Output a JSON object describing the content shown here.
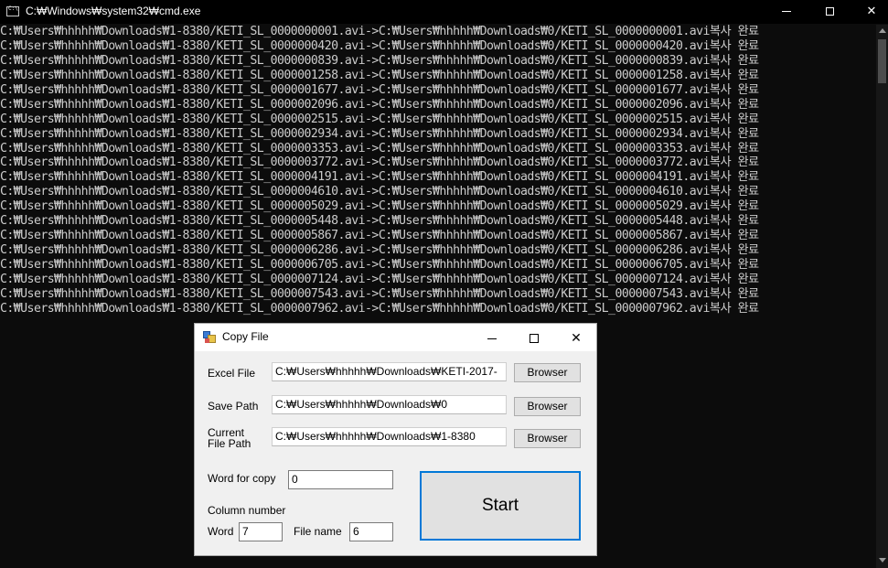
{
  "cmd": {
    "title": "C:₩Windows₩system32₩cmd.exe",
    "lines": [
      "C:₩Users₩hhhhh₩Downloads₩1-8380/KETI_SL_0000000001.avi->C:₩Users₩hhhhh₩Downloads₩0/KETI_SL_0000000001.avi복사 완료",
      "C:₩Users₩hhhhh₩Downloads₩1-8380/KETI_SL_0000000420.avi->C:₩Users₩hhhhh₩Downloads₩0/KETI_SL_0000000420.avi복사 완료",
      "C:₩Users₩hhhhh₩Downloads₩1-8380/KETI_SL_0000000839.avi->C:₩Users₩hhhhh₩Downloads₩0/KETI_SL_0000000839.avi복사 완료",
      "C:₩Users₩hhhhh₩Downloads₩1-8380/KETI_SL_0000001258.avi->C:₩Users₩hhhhh₩Downloads₩0/KETI_SL_0000001258.avi복사 완료",
      "C:₩Users₩hhhhh₩Downloads₩1-8380/KETI_SL_0000001677.avi->C:₩Users₩hhhhh₩Downloads₩0/KETI_SL_0000001677.avi복사 완료",
      "C:₩Users₩hhhhh₩Downloads₩1-8380/KETI_SL_0000002096.avi->C:₩Users₩hhhhh₩Downloads₩0/KETI_SL_0000002096.avi복사 완료",
      "C:₩Users₩hhhhh₩Downloads₩1-8380/KETI_SL_0000002515.avi->C:₩Users₩hhhhh₩Downloads₩0/KETI_SL_0000002515.avi복사 완료",
      "C:₩Users₩hhhhh₩Downloads₩1-8380/KETI_SL_0000002934.avi->C:₩Users₩hhhhh₩Downloads₩0/KETI_SL_0000002934.avi복사 완료",
      "C:₩Users₩hhhhh₩Downloads₩1-8380/KETI_SL_0000003353.avi->C:₩Users₩hhhhh₩Downloads₩0/KETI_SL_0000003353.avi복사 완료",
      "C:₩Users₩hhhhh₩Downloads₩1-8380/KETI_SL_0000003772.avi->C:₩Users₩hhhhh₩Downloads₩0/KETI_SL_0000003772.avi복사 완료",
      "C:₩Users₩hhhhh₩Downloads₩1-8380/KETI_SL_0000004191.avi->C:₩Users₩hhhhh₩Downloads₩0/KETI_SL_0000004191.avi복사 완료",
      "C:₩Users₩hhhhh₩Downloads₩1-8380/KETI_SL_0000004610.avi->C:₩Users₩hhhhh₩Downloads₩0/KETI_SL_0000004610.avi복사 완료",
      "C:₩Users₩hhhhh₩Downloads₩1-8380/KETI_SL_0000005029.avi->C:₩Users₩hhhhh₩Downloads₩0/KETI_SL_0000005029.avi복사 완료",
      "C:₩Users₩hhhhh₩Downloads₩1-8380/KETI_SL_0000005448.avi->C:₩Users₩hhhhh₩Downloads₩0/KETI_SL_0000005448.avi복사 완료",
      "C:₩Users₩hhhhh₩Downloads₩1-8380/KETI_SL_0000005867.avi->C:₩Users₩hhhhh₩Downloads₩0/KETI_SL_0000005867.avi복사 완료",
      "C:₩Users₩hhhhh₩Downloads₩1-8380/KETI_SL_0000006286.avi->C:₩Users₩hhhhh₩Downloads₩0/KETI_SL_0000006286.avi복사 완료",
      "C:₩Users₩hhhhh₩Downloads₩1-8380/KETI_SL_0000006705.avi->C:₩Users₩hhhhh₩Downloads₩0/KETI_SL_0000006705.avi복사 완료",
      "C:₩Users₩hhhhh₩Downloads₩1-8380/KETI_SL_0000007124.avi->C:₩Users₩hhhhh₩Downloads₩0/KETI_SL_0000007124.avi복사 완료",
      "C:₩Users₩hhhhh₩Downloads₩1-8380/KETI_SL_0000007543.avi->C:₩Users₩hhhhh₩Downloads₩0/KETI_SL_0000007543.avi복사 완료",
      "C:₩Users₩hhhhh₩Downloads₩1-8380/KETI_SL_0000007962.avi->C:₩Users₩hhhhh₩Downloads₩0/KETI_SL_0000007962.avi복사 완료"
    ]
  },
  "dialog": {
    "title": "Copy File",
    "excel_label": "Excel File",
    "excel_value": "C:₩Users₩hhhhh₩Downloads₩KETI-2017-",
    "save_label": "Save Path",
    "save_value": "C:₩Users₩hhhhh₩Downloads₩0",
    "current_label_line1": "Current",
    "current_label_line2": "File Path",
    "current_value": "C:₩Users₩hhhhh₩Downloads₩1-8380",
    "browse_label": "Browser",
    "word_for_copy_label": "Word for copy",
    "word_for_copy_value": "0",
    "column_number_label": "Column number",
    "word_label": "Word",
    "word_value": "7",
    "file_name_label": "File name",
    "file_name_value": "6",
    "start_label": "Start"
  },
  "colors": {
    "console_bg": "#0c0c0c",
    "console_text": "#cccccc",
    "dialog_bg": "#f0f0f0",
    "focus_accent": "#0078d7"
  },
  "icons": {
    "cmd_window_icon": "console-icon",
    "dialog_window_icon": "winforms-app-icon"
  }
}
